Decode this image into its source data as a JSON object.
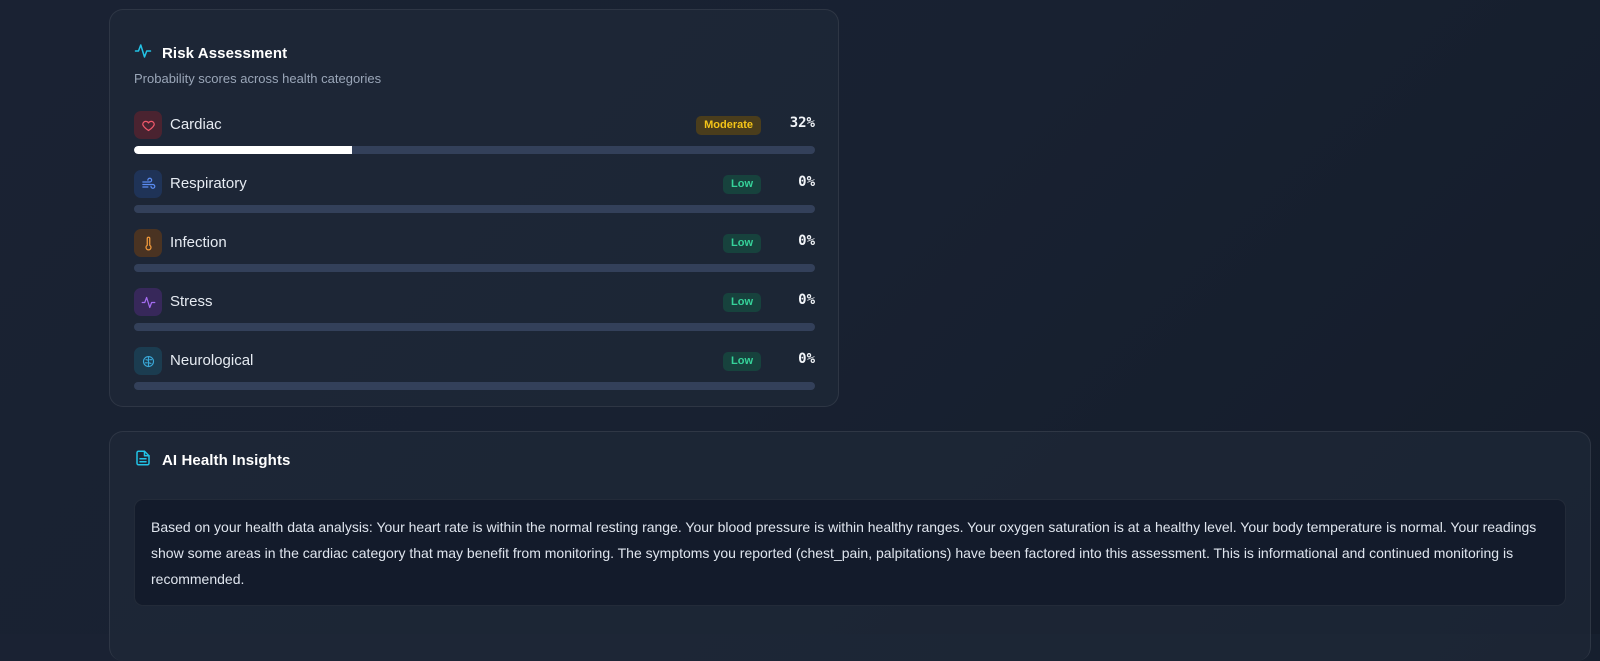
{
  "risk": {
    "title": "Risk Assessment",
    "subtitle": "Probability scores across health categories",
    "items": [
      {
        "label": "Cardiac",
        "level": "Moderate",
        "percent": "32%",
        "value": 0.32,
        "icon": "heart-icon",
        "color": "#f0586a"
      },
      {
        "label": "Respiratory",
        "level": "Low",
        "percent": "0%",
        "value": 0,
        "icon": "wind-icon",
        "color": "#5b8cf2"
      },
      {
        "label": "Infection",
        "level": "Low",
        "percent": "0%",
        "value": 0,
        "icon": "thermometer-icon",
        "color": "#f29a3c"
      },
      {
        "label": "Stress",
        "level": "Low",
        "percent": "0%",
        "value": 0,
        "icon": "activity-icon",
        "color": "#a36cf0"
      },
      {
        "label": "Neurological",
        "level": "Low",
        "percent": "0%",
        "value": 0,
        "icon": "brain-icon",
        "color": "#3aa8d8"
      }
    ]
  },
  "insights": {
    "title": "AI Health Insights",
    "text": "Based on your health data analysis: Your heart rate is within the normal resting range. Your blood pressure is within healthy ranges. Your oxygen saturation is at a healthy level. Your body temperature is normal. Your readings show some areas in the cardiac category that may benefit from monitoring. The symptoms you reported (chest_pain, palpitations) have been factored into this assessment. This is informational and continued monitoring is recommended."
  },
  "colors": {
    "accent": "#22c3e6",
    "moderate": "#f5c518",
    "low": "#36d39a",
    "bar_fill": "#ffffff",
    "bar_track": "#33405a"
  }
}
